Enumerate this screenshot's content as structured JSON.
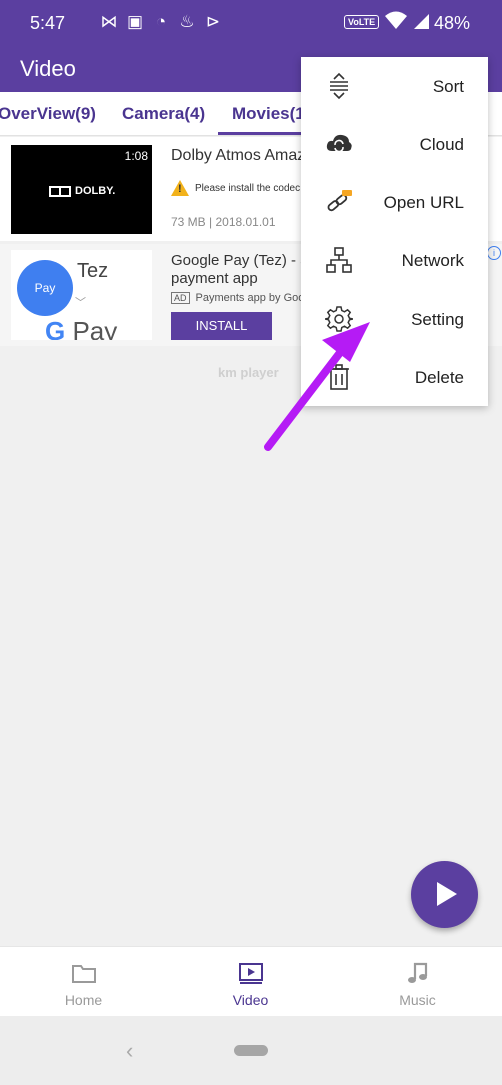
{
  "status_bar": {
    "time": "5:47",
    "network_badge": "VoLTE",
    "battery": "48%"
  },
  "app_bar": {
    "title": "Video"
  },
  "tabs": [
    {
      "label": "OverView(9)"
    },
    {
      "label": "Camera(4)"
    },
    {
      "label": "Movies(1"
    }
  ],
  "list": [
    {
      "type": "video",
      "duration": "1:08",
      "thumb_text": "DOLBY.",
      "title": "Dolby Atmos Amaz",
      "warning": "Please install the codec",
      "meta": "73 MB | 2018.01.01"
    },
    {
      "type": "ad",
      "thumb_brand": "Tez",
      "thumb_circle": "Pay",
      "thumb_logo_g": "G",
      "thumb_logo_text": "Pay",
      "title": "Google Pay (Tez) - a payment app",
      "ad_badge": "AD",
      "ad_text": "Payments app by Goo",
      "install_label": "INSTALL"
    }
  ],
  "watermark": "km player",
  "menu": [
    {
      "label": "Sort",
      "icon": "sort-icon"
    },
    {
      "label": "Cloud",
      "icon": "cloud-sync-icon"
    },
    {
      "label": "Open URL",
      "icon": "link-icon"
    },
    {
      "label": "Network",
      "icon": "network-icon"
    },
    {
      "label": "Setting",
      "icon": "gear-icon"
    },
    {
      "label": "Delete",
      "icon": "trash-icon"
    }
  ],
  "bottom_nav": [
    {
      "label": "Home",
      "icon": "folder-icon"
    },
    {
      "label": "Video",
      "icon": "video-icon",
      "active": true
    },
    {
      "label": "Music",
      "icon": "music-note-icon"
    }
  ],
  "colors": {
    "primary": "#5b3fa0",
    "annotation_arrow": "#b51bf5",
    "warning": "#f2b21b"
  }
}
